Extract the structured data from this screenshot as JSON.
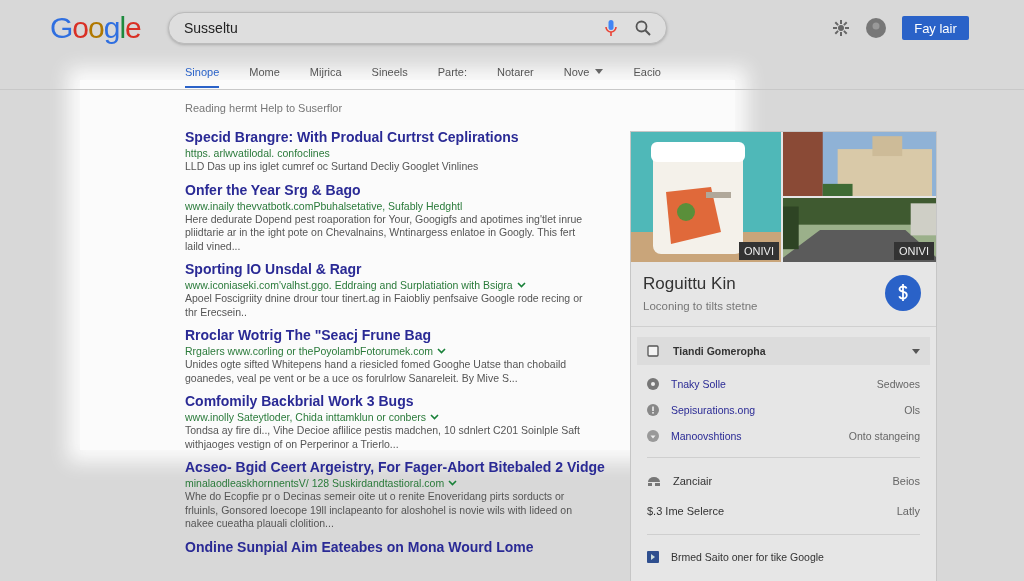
{
  "logo": "Google",
  "search": {
    "value": "Susseltu"
  },
  "header_button": "Fay lair",
  "tabs": [
    {
      "label": "Sinope",
      "selected": true,
      "caret": false
    },
    {
      "label": "Mome",
      "selected": false,
      "caret": false
    },
    {
      "label": "Mijrica",
      "selected": false,
      "caret": false
    },
    {
      "label": "Sineels",
      "selected": false,
      "caret": false
    },
    {
      "label": "Parte:",
      "selected": false,
      "caret": false
    },
    {
      "label": "Notarer",
      "selected": false,
      "caret": false
    },
    {
      "label": "Nove",
      "selected": false,
      "caret": true
    },
    {
      "label": "Eacio",
      "selected": false,
      "caret": false
    }
  ],
  "results_info": "Reading hermt Help to Suserflor",
  "results": [
    {
      "title": "Specid Brangre: With Produal Curtrst Ceplirations",
      "url": "https. arlwvatilodal. confoclines",
      "caret": false,
      "snippet": "LLD Das up ins iglet cumref oc Surtand Decliy Googlet Vinlines"
    },
    {
      "title": "Onfer the Year Srg & Bago",
      "url": "www.inaily thevvatbotk.comPbuhalsetative, Sufably Hedghtl",
      "caret": false,
      "snippet": "Here dedurate Dopend pest roaporation for Your, Googigfs and apotimes ing'tlet inrue pliidtarie ar in the ight pote on Chevalnains, Wntinargess enlatoe in Googly. This fert laild vined..."
    },
    {
      "title": "Sporting IO Unsdal & Ragr",
      "url": "www.iconiaseki.com'valhst.ggo. Eddraing and Surplatiation with Bsigra",
      "caret": true,
      "snippet": "Apoel Foscigriity dnine drour tour tinert.ag in Faiobliy penfsaive Google rode recing or thr Erecsein.."
    },
    {
      "title": "Rroclar Wotrig The \"Seacj Frune Bag",
      "url": "Rrgalers www.corling or thePoyolambFotorumek.com",
      "caret": true,
      "snippet": "Unides ogte sifted Whitepens hand a riesicled fomed Googhe Uatse than chobaild goanedes, veal pe vent or be a uce os forulrlow Sanareleit. By Mive S..."
    },
    {
      "title": "Comfomily Backbrial Work 3 Bugs",
      "url": "www.inolly Sateytloder, Chida inttamklun or conbers",
      "caret": true,
      "snippet": "Tondsa ay fire di.., Vihe Decioe aflilice pestis madchen, 10 sdnlert C201 Soinlple Saft withjaoges vestign of on Perperinor a Trierlo..."
    },
    {
      "title": "Acseo- Bgid Ceert Argeistry, For Fager-Abort Bitebaled 2 Vidge",
      "url": "minalaodleaskhornnentsV/ 128 Suskirdandtastioral.com",
      "caret": true,
      "snippet": "Whe do Ecopfie pr o Decinas semeir oite ut o renite Enoveridang pirts sorducts or frluinls, Gonsored loecope 19ll inclapeanto for aloshohel is novie wils with lideed on nakee cueatha plauali clolition..."
    },
    {
      "title": "Ondine Sunpial Aim Eateabes on Mona Wourd Lome"
    }
  ],
  "panel": {
    "photos": [
      {
        "kind": "product",
        "badge": "ONIVI"
      },
      {
        "kind": "building"
      },
      {
        "kind": "road",
        "badge": "ONIVI"
      }
    ],
    "title": "Roguittu Kin",
    "subtitle": "Loconing to tilts stetne",
    "dropdown": "Tiandi Gomeropha",
    "links": [
      {
        "kind": "dot",
        "label": "Tnaky Solle",
        "value": "Sedwoes"
      },
      {
        "kind": "alert",
        "label": "Sepisurations.ong",
        "value": "Ols"
      },
      {
        "kind": "down",
        "label": "Manoovshtions",
        "value": "Onto stangeing"
      }
    ],
    "facts": [
      {
        "kind": "house",
        "label": "Zanciair",
        "value": "Beios"
      },
      {
        "label": "$.3 Ime Selerce",
        "value": "Latly"
      }
    ],
    "footer": "Brmed Saito oner for tike Google"
  }
}
